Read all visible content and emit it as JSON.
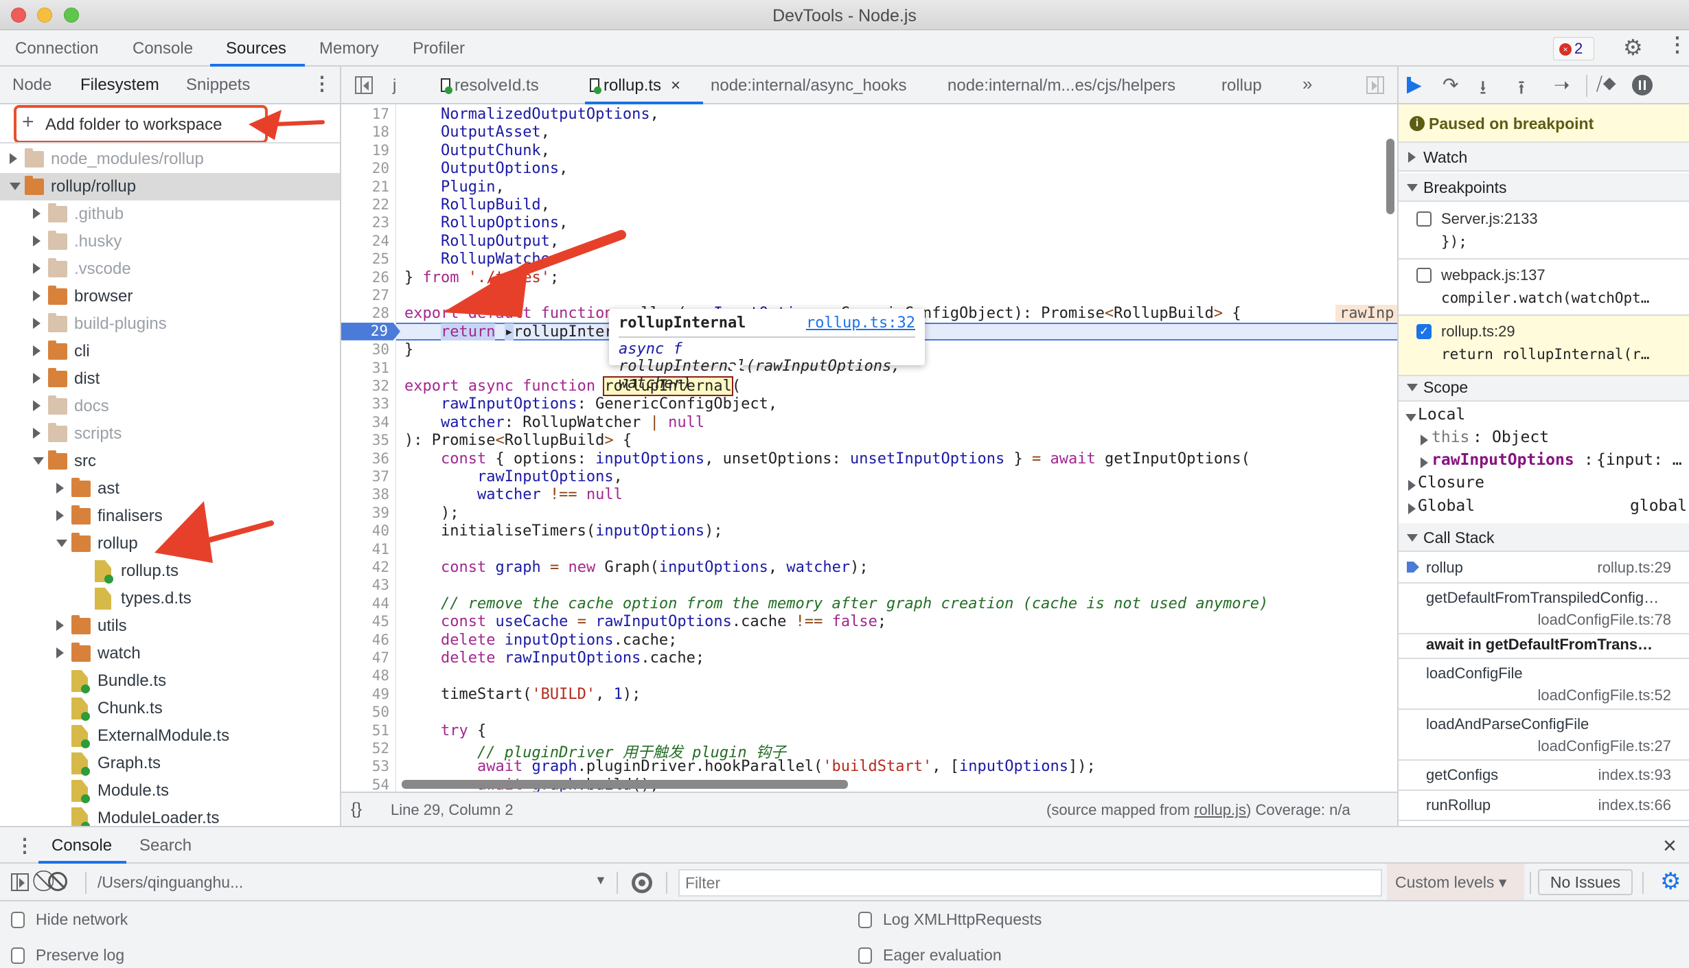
{
  "window": {
    "title": "DevTools - Node.js"
  },
  "main_tabs": [
    {
      "label": "Connection",
      "active": false
    },
    {
      "label": "Console",
      "active": false
    },
    {
      "label": "Sources",
      "active": true
    },
    {
      "label": "Memory",
      "active": false
    },
    {
      "label": "Profiler",
      "active": false
    }
  ],
  "toolbar_right": {
    "error_count": "2",
    "settings_icon": "gear-icon",
    "more_icon": "kebab-icon"
  },
  "sidebar": {
    "tabs": [
      {
        "label": "Node",
        "active": false
      },
      {
        "label": "Filesystem",
        "active": true
      },
      {
        "label": "Snippets",
        "active": false
      }
    ],
    "add_folder_label": "Add folder to workspace",
    "tree": [
      {
        "label": "node_modules/rollup",
        "type": "folder",
        "depth": 0,
        "expanded": false,
        "dim": true
      },
      {
        "label": "rollup/rollup",
        "type": "folder",
        "depth": 0,
        "expanded": true,
        "selected": true
      },
      {
        "label": ".github",
        "type": "folder",
        "depth": 1,
        "expanded": false,
        "dim": true
      },
      {
        "label": ".husky",
        "type": "folder",
        "depth": 1,
        "expanded": false,
        "dim": true
      },
      {
        "label": ".vscode",
        "type": "folder",
        "depth": 1,
        "expanded": false,
        "dim": true
      },
      {
        "label": "browser",
        "type": "folder",
        "depth": 1,
        "expanded": false
      },
      {
        "label": "build-plugins",
        "type": "folder",
        "depth": 1,
        "expanded": false,
        "dim": true
      },
      {
        "label": "cli",
        "type": "folder",
        "depth": 1,
        "expanded": false
      },
      {
        "label": "dist",
        "type": "folder",
        "depth": 1,
        "expanded": false
      },
      {
        "label": "docs",
        "type": "folder",
        "depth": 1,
        "expanded": false,
        "dim": true
      },
      {
        "label": "scripts",
        "type": "folder",
        "depth": 1,
        "expanded": false,
        "dim": true
      },
      {
        "label": "src",
        "type": "folder",
        "depth": 1,
        "expanded": true
      },
      {
        "label": "ast",
        "type": "folder",
        "depth": 2,
        "expanded": false
      },
      {
        "label": "finalisers",
        "type": "folder",
        "depth": 2,
        "expanded": false
      },
      {
        "label": "rollup",
        "type": "folder",
        "depth": 2,
        "expanded": true
      },
      {
        "label": "rollup.ts",
        "type": "file",
        "depth": 3,
        "mapped": true
      },
      {
        "label": "types.d.ts",
        "type": "file",
        "depth": 3,
        "mapped": false
      },
      {
        "label": "utils",
        "type": "folder",
        "depth": 2,
        "expanded": false
      },
      {
        "label": "watch",
        "type": "folder",
        "depth": 2,
        "expanded": false
      },
      {
        "label": "Bundle.ts",
        "type": "file",
        "depth": 2,
        "mapped": true
      },
      {
        "label": "Chunk.ts",
        "type": "file",
        "depth": 2,
        "mapped": true
      },
      {
        "label": "ExternalModule.ts",
        "type": "file",
        "depth": 2,
        "mapped": true
      },
      {
        "label": "Graph.ts",
        "type": "file",
        "depth": 2,
        "mapped": true
      },
      {
        "label": "Module.ts",
        "type": "file",
        "depth": 2,
        "mapped": true
      },
      {
        "label": "ModuleLoader.ts",
        "type": "file",
        "depth": 2,
        "mapped": true
      }
    ]
  },
  "editor": {
    "tabs": [
      {
        "label": "j",
        "icon": false
      },
      {
        "label": "resolveId.ts",
        "icon": true
      },
      {
        "label": "rollup.ts",
        "icon": true,
        "active": true,
        "closable": true
      },
      {
        "label": "node:internal/async_hooks",
        "icon": false
      },
      {
        "label": "node:internal/m...es/cjs/helpers",
        "icon": false
      },
      {
        "label": "rollup",
        "icon": false
      }
    ],
    "more_tabs": "»",
    "close_glyph": "×",
    "lines": [
      {
        "n": "17",
        "html": "    <span class='id'>NormalizedOutputOptions</span>,"
      },
      {
        "n": "18",
        "html": "    <span class='id'>OutputAsset</span>,"
      },
      {
        "n": "19",
        "html": "    <span class='id'>OutputChunk</span>,"
      },
      {
        "n": "20",
        "html": "    <span class='id'>OutputOptions</span>,"
      },
      {
        "n": "21",
        "html": "    <span class='id'>Plugin</span>,"
      },
      {
        "n": "22",
        "html": "    <span class='id'>RollupBuild</span>,"
      },
      {
        "n": "23",
        "html": "    <span class='id'>RollupOptions</span>,"
      },
      {
        "n": "24",
        "html": "    <span class='id'>RollupOutput</span>,"
      },
      {
        "n": "25",
        "html": "    <span class='id'>RollupWatcher</span>"
      },
      {
        "n": "26",
        "html": "} <span class='kw'>from</span> <span class='str'>'./types'</span>;"
      },
      {
        "n": "27",
        "html": ""
      },
      {
        "n": "28",
        "html": "<span class='kw'>export default function</span> rollup(<span class='id'>rawInputOptions</span>: GenericConfigObject): Promise<span class='op'>&lt;</span>RollupBuild<span class='op'>&gt;</span> {"
      },
      {
        "n": "29",
        "html": ""
      },
      {
        "n": "30",
        "html": "}"
      },
      {
        "n": "31",
        "html": ""
      },
      {
        "n": "32",
        "html": "<span class='kw'>export async function</span> <span class='hl-word'>rollupInternal</span>("
      },
      {
        "n": "33",
        "html": "    <span class='id'>rawInputOptions</span>: GenericConfigObject,"
      },
      {
        "n": "34",
        "html": "    <span class='id'>watcher</span>: RollupWatcher <span class='op'>|</span> <span class='kw'>null</span>"
      },
      {
        "n": "35",
        "html": "): Promise<span class='op'>&lt;</span>RollupBuild<span class='op'>&gt;</span> {"
      },
      {
        "n": "36",
        "html": "    <span class='kw'>const</span> { options: <span class='id'>inputOptions</span>, unsetOptions: <span class='id'>unsetInputOptions</span> } <span class='op'>=</span> <span class='kw'>await</span> getInputOptions("
      },
      {
        "n": "37",
        "html": "        <span class='id'>rawInputOptions</span>,"
      },
      {
        "n": "38",
        "html": "        <span class='id'>watcher</span> <span class='op'>!==</span> <span class='kw'>null</span>"
      },
      {
        "n": "39",
        "html": "    );"
      },
      {
        "n": "40",
        "html": "    initialiseTimers(<span class='id'>inputOptions</span>);"
      },
      {
        "n": "41",
        "html": ""
      },
      {
        "n": "42",
        "html": "    <span class='kw'>const</span> <span class='id'>graph</span> <span class='op'>=</span> <span class='kw'>new</span> Graph(<span class='id'>inputOptions</span>, <span class='id'>watcher</span>);"
      },
      {
        "n": "43",
        "html": ""
      },
      {
        "n": "44",
        "html": "    <span class='cm'>// remove the cache option from the memory after graph creation (cache is not used anymore)</span>"
      },
      {
        "n": "45",
        "html": "    <span class='kw'>const</span> <span class='id'>useCache</span> <span class='op'>=</span> <span class='id'>rawInputOptions</span>.cache <span class='op'>!==</span> <span class='kw'>false</span>;"
      },
      {
        "n": "46",
        "html": "    <span class='kw'>delete</span> <span class='id'>inputOptions</span>.cache;"
      },
      {
        "n": "47",
        "html": "    <span class='kw'>delete</span> <span class='id'>rawInputOptions</span>.cache;"
      },
      {
        "n": "48",
        "html": ""
      },
      {
        "n": "49",
        "html": "    timeStart(<span class='str'>'BUILD'</span>, <span class='num'>1</span>);"
      },
      {
        "n": "50",
        "html": ""
      },
      {
        "n": "51",
        "html": "    <span class='kw'>try</span> {"
      },
      {
        "n": "52",
        "html": "        <span class='cm'>// pluginDriver 用于触发 plugin 钩子</span>"
      },
      {
        "n": "53",
        "html": "        <span class='kw'>await</span> <span class='id'>graph</span>.pluginDriver.hookParallel(<span class='str'>'buildStart'</span>, [<span class='id'>inputOptions</span>]);"
      },
      {
        "n": "54",
        "html": "        <span class='kw'>await</span> <span class='id'>graph</span>.build();"
      }
    ],
    "exec_line_number": "29",
    "exec_line_html": "    <span style='background:#c7d5f5;color:#a3278f'>return</span> <span style='background:#c7d5f5'>&#9656;</span>rollupInternal(<span class='id'>rawInputOptions</span>, <span class='kw'>null</span>);",
    "inline_hint": "rawInp",
    "hover_popup": {
      "name": "rollupInternal",
      "link": "rollup.ts:32",
      "signature_prefix": "async f",
      "signature": "rollupInternal(rawInputOptions, watcher)"
    },
    "status": {
      "braces": "{}",
      "position": "Line 29, Column 2",
      "source_mapped_prefix": "(source mapped from ",
      "source_mapped_link": "rollup.js",
      "source_mapped_suffix": ")",
      "coverage": "Coverage: n/a"
    }
  },
  "debugger": {
    "paused_message": "Paused on breakpoint",
    "sections": {
      "watch": "Watch",
      "breakpoints": "Breakpoints",
      "scope": "Scope",
      "call_stack": "Call Stack"
    },
    "breakpoints": [
      {
        "file": "Server.js:2133",
        "code": "});",
        "checked": false
      },
      {
        "file": "webpack.js:137",
        "code": "compiler.watch(watchOpt…",
        "checked": false
      },
      {
        "file": "rollup.ts:29",
        "code": "return rollupInternal(r…",
        "checked": true,
        "active": true
      }
    ],
    "scope": {
      "local": "Local",
      "this_key": "this",
      "this_val": "Object",
      "raw_key": "rawInputOptions",
      "raw_val": "{input: …",
      "closure": "Closure",
      "global": "Global",
      "global_val": "global"
    },
    "call_stack": [
      {
        "fn": "rollup",
        "loc": "rollup.ts:29",
        "current": true,
        "two_line": false
      },
      {
        "fn": "getDefaultFromTranspiledConfig…",
        "loc": "loadConfigFile.ts:78",
        "two_line": true
      },
      {
        "fn": "await in getDefaultFromTrans…",
        "loc": "",
        "async_sep": true
      },
      {
        "fn": "loadConfigFile",
        "loc": "loadConfigFile.ts:52",
        "two_line": true
      },
      {
        "fn": "loadAndParseConfigFile",
        "loc": "loadConfigFile.ts:27",
        "two_line": true
      },
      {
        "fn": "getConfigs",
        "loc": "index.ts:93",
        "two_line": false
      },
      {
        "fn": "runRollup",
        "loc": "index.ts:66",
        "two_line": false
      }
    ]
  },
  "drawer": {
    "tabs": [
      {
        "label": "Console",
        "active": true
      },
      {
        "label": "Search",
        "active": false
      }
    ],
    "context": "/Users/qinguanghu...",
    "filter_placeholder": "Filter",
    "levels": "Custom levels ▾",
    "issues": "No Issues",
    "close_glyph": "×",
    "checkboxes_left": [
      {
        "label": "Hide network",
        "checked": false
      },
      {
        "label": "Preserve log",
        "checked": false
      }
    ],
    "checkboxes_right": [
      {
        "label": "Log XMLHttpRequests",
        "checked": false
      },
      {
        "label": "Eager evaluation",
        "checked": false
      }
    ]
  },
  "colors": {
    "accent": "#1a73e8",
    "annotation": "#e7502c",
    "paused_bg": "#fffbdb"
  }
}
